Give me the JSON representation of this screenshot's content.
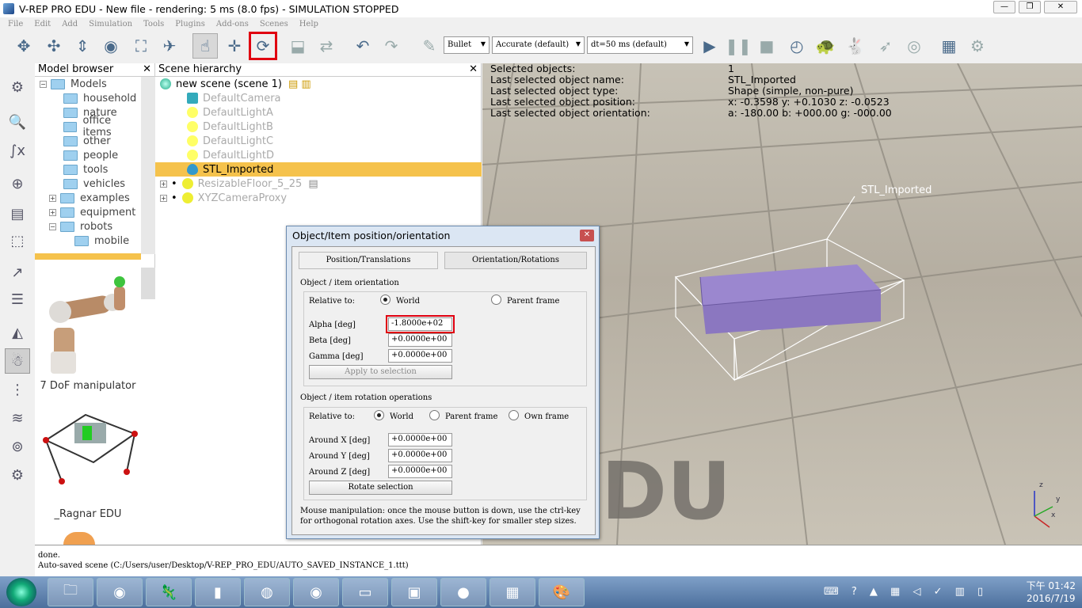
{
  "window": {
    "title": "V-REP PRO EDU - New file - rendering: 5 ms (8.0 fps) - SIMULATION STOPPED"
  },
  "menu": [
    "File",
    "Edit",
    "Add",
    "Simulation",
    "Tools",
    "Plugins",
    "Add-ons",
    "Scenes",
    "Help"
  ],
  "toolbar": {
    "engine": "Bullet",
    "accuracy": "Accurate (default)",
    "dt": "dt=50 ms (default)"
  },
  "model_browser": {
    "title": "Model browser",
    "root": "Models",
    "items": [
      "household",
      "nature",
      "office items",
      "other",
      "people",
      "tools",
      "vehicles",
      "examples",
      "equipment",
      "robots"
    ],
    "subitem": "mobile",
    "thumbs": [
      "7 DoF manipulator",
      "_Ragnar EDU"
    ]
  },
  "scene_hierarchy": {
    "title": "Scene hierarchy",
    "root": "new scene (scene 1)",
    "objects": [
      "DefaultCamera",
      "DefaultLightA",
      "DefaultLightB",
      "DefaultLightC",
      "DefaultLightD",
      "STL_Imported",
      "ResizableFloor_5_25",
      "XYZCameraProxy"
    ]
  },
  "viewport": {
    "info": [
      {
        "k": "Selected objects:",
        "v": "1"
      },
      {
        "k": "Last selected object name:",
        "v": "STL_Imported"
      },
      {
        "k": "Last selected object type:",
        "v": "Shape (simple, non-pure)"
      },
      {
        "k": "Last selected object position:",
        "v": "x: -0.3598    y: +0.1030    z: -0.0523"
      },
      {
        "k": "Last selected object orientation:",
        "v": "a: -180.00    b: +000.00    g: -000.00"
      }
    ],
    "object_label": "STL_Imported",
    "watermark": "DU",
    "axes": [
      "z",
      "y",
      "x"
    ]
  },
  "dialog": {
    "title": "Object/Item position/orientation",
    "tab1": "Position/Translations",
    "tab2": "Orientation/Rotations",
    "section1": "Object / item orientation",
    "relative_to": "Relative to:",
    "world": "World",
    "parent_frame": "Parent frame",
    "own_frame": "Own frame",
    "alpha_label": "Alpha [deg]",
    "alpha_value": "-1.8000e+02",
    "beta_label": "Beta [deg]",
    "beta_value": "+0.0000e+00",
    "gamma_label": "Gamma [deg]",
    "gamma_value": "+0.0000e+00",
    "apply": "Apply to selection",
    "section2": "Object / item rotation operations",
    "ax_label": "Around X [deg]",
    "ax_value": "+0.0000e+00",
    "ay_label": "Around Y [deg]",
    "ay_value": "+0.0000e+00",
    "az_label": "Around Z [deg]",
    "az_value": "+0.0000e+00",
    "rotate": "Rotate selection",
    "help": "Mouse manipulation: once the mouse button is down, use the ctrl-key for orthogonal rotation axes. Use the shift-key for smaller step sizes."
  },
  "log": {
    "line1": "done.",
    "line2": "Auto-saved scene (C:/Users/user/Desktop/V-REP_PRO_EDU/AUTO_SAVED_INSTANCE_1.ttt)"
  },
  "taskbar": {
    "time": "下午 01:42",
    "date": "2016/7/19"
  }
}
